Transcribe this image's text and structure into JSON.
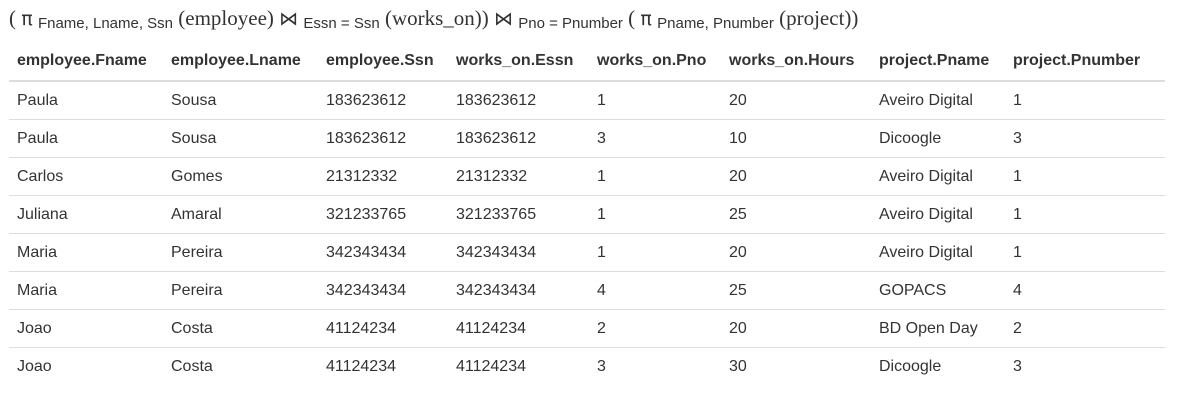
{
  "expression": {
    "open1": "(",
    "pi1": "π",
    "proj1_attrs": "Fname, Lname, Ssn",
    "rel1": "(employee)",
    "join1_sym": "⋈",
    "join1_cond": "Essn = Ssn",
    "rel2": "(works_on))",
    "join2_sym": "⋈",
    "join2_cond": "Pno = Pnumber",
    "open2": "(",
    "pi2": "π",
    "proj2_attrs": "Pname, Pnumber",
    "rel3": "(project))"
  },
  "table": {
    "headers": [
      "employee.Fname",
      "employee.Lname",
      "employee.Ssn",
      "works_on.Essn",
      "works_on.Pno",
      "works_on.Hours",
      "project.Pname",
      "project.Pnumber"
    ],
    "rows": [
      [
        "Paula",
        "Sousa",
        "183623612",
        "183623612",
        "1",
        "20",
        "Aveiro Digital",
        "1"
      ],
      [
        "Paula",
        "Sousa",
        "183623612",
        "183623612",
        "3",
        "10",
        "Dicoogle",
        "3"
      ],
      [
        "Carlos",
        "Gomes",
        "21312332",
        "21312332",
        "1",
        "20",
        "Aveiro Digital",
        "1"
      ],
      [
        "Juliana",
        "Amaral",
        "321233765",
        "321233765",
        "1",
        "25",
        "Aveiro Digital",
        "1"
      ],
      [
        "Maria",
        "Pereira",
        "342343434",
        "342343434",
        "1",
        "20",
        "Aveiro Digital",
        "1"
      ],
      [
        "Maria",
        "Pereira",
        "342343434",
        "342343434",
        "4",
        "25",
        "GOPACS",
        "4"
      ],
      [
        "Joao",
        "Costa",
        "41124234",
        "41124234",
        "2",
        "20",
        "BD Open Day",
        "2"
      ],
      [
        "Joao",
        "Costa",
        "41124234",
        "41124234",
        "3",
        "30",
        "Dicoogle",
        "3"
      ]
    ]
  }
}
